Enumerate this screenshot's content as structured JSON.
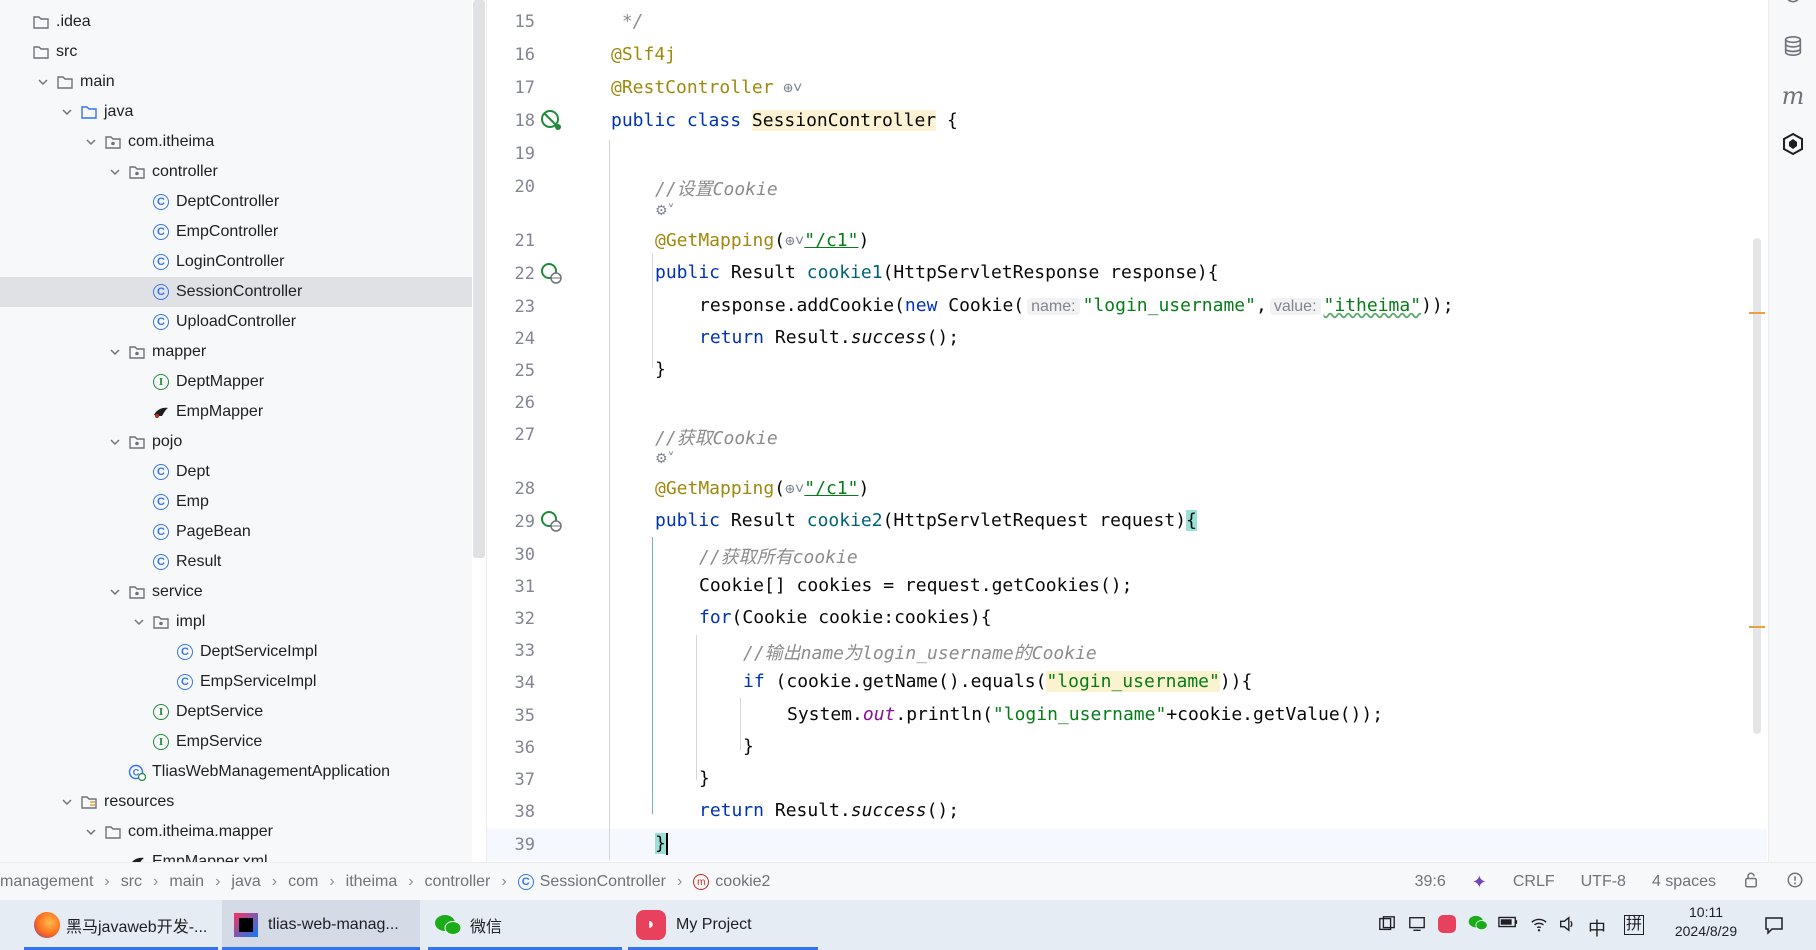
{
  "project_tree": {
    "items": [
      {
        "label": ".idea",
        "type": "folder",
        "expanded": false
      },
      {
        "label": "src",
        "type": "folder",
        "expanded": false
      },
      {
        "label": "main",
        "type": "folder",
        "expanded": true
      },
      {
        "label": "java",
        "type": "source-folder",
        "expanded": true
      },
      {
        "label": "com.itheima",
        "type": "package",
        "expanded": true
      },
      {
        "label": "controller",
        "type": "package",
        "expanded": true
      },
      {
        "label": "DeptController",
        "type": "class"
      },
      {
        "label": "EmpController",
        "type": "class"
      },
      {
        "label": "LoginController",
        "type": "class"
      },
      {
        "label": "SessionController",
        "type": "class",
        "selected": true
      },
      {
        "label": "UploadController",
        "type": "class"
      },
      {
        "label": "mapper",
        "type": "package",
        "expanded": true
      },
      {
        "label": "DeptMapper",
        "type": "interface"
      },
      {
        "label": "EmpMapper",
        "type": "mapper"
      },
      {
        "label": "pojo",
        "type": "package",
        "expanded": true
      },
      {
        "label": "Dept",
        "type": "class"
      },
      {
        "label": "Emp",
        "type": "class"
      },
      {
        "label": "PageBean",
        "type": "class"
      },
      {
        "label": "Result",
        "type": "class"
      },
      {
        "label": "service",
        "type": "package",
        "expanded": true
      },
      {
        "label": "impl",
        "type": "package",
        "expanded": true
      },
      {
        "label": "DeptServiceImpl",
        "type": "class"
      },
      {
        "label": "EmpServiceImpl",
        "type": "class"
      },
      {
        "label": "DeptService",
        "type": "interface"
      },
      {
        "label": "EmpService",
        "type": "interface"
      },
      {
        "label": "TliasWebManagementApplication",
        "type": "app"
      },
      {
        "label": "resources",
        "type": "resource-folder",
        "expanded": true
      },
      {
        "label": "com.itheima.mapper",
        "type": "folder",
        "expanded": true
      },
      {
        "label": "EmpMapper.xml",
        "type": "xml"
      }
    ]
  },
  "editor": {
    "lines": {
      "l15": {
        "no": "15",
        "text": " */"
      },
      "l16": {
        "no": "16",
        "text": "@Slf4j"
      },
      "l17": {
        "no": "17",
        "text": "@RestController"
      },
      "l18": {
        "no": "18",
        "kw1": "public",
        "kw2": "class",
        "cls": "SessionController",
        "rest": " {"
      },
      "l19": {
        "no": "19"
      },
      "l20": {
        "no": "20",
        "text": "//设置Cookie"
      },
      "l21": {
        "no": "21",
        "ann": "@GetMapping",
        "open": "(",
        "str": "\"/c1\"",
        "close": ")"
      },
      "l22": {
        "no": "22",
        "kw": "public",
        "a": " Result ",
        "fn": "cookie1",
        "b": "(HttpServletResponse response){"
      },
      "l23": {
        "no": "23",
        "a": "response.addCookie(",
        "kw": "new",
        "b": " Cookie(",
        "hint1": "name:",
        "s1": "\"login_username\"",
        "c": ",",
        "hint2": "value:",
        "s2": "\"itheima\"",
        "d": "));"
      },
      "l24": {
        "no": "24",
        "kw": "return",
        "a": " Result.",
        "it": "success",
        "b": "();"
      },
      "l25": {
        "no": "25",
        "text": "}"
      },
      "l26": {
        "no": "26"
      },
      "l27": {
        "no": "27",
        "text": "//获取Cookie"
      },
      "l28": {
        "no": "28",
        "ann": "@GetMapping",
        "open": "(",
        "str": "\"/c1\"",
        "close": ")"
      },
      "l29": {
        "no": "29",
        "kw": "public",
        "a": " Result ",
        "fn": "cookie2",
        "b": "(HttpServletRequest request)",
        "brace": "{"
      },
      "l30": {
        "no": "30",
        "text": "//获取所有cookie"
      },
      "l31": {
        "no": "31",
        "text": "Cookie[] cookies = request.getCookies();"
      },
      "l32": {
        "no": "32",
        "kw": "for",
        "a": "(Cookie cookie:cookies){"
      },
      "l33": {
        "no": "33",
        "text": "//输出name为login_username的Cookie"
      },
      "l34": {
        "no": "34",
        "kw": "if",
        "a": " (cookie.getName().equals(",
        "str": "\"login_username\"",
        "b": ")){"
      },
      "l35": {
        "no": "35",
        "a": "System.",
        "st": "out",
        "b": ".println(",
        "str": "\"login_username\"",
        "c": "+cookie.getValue());"
      },
      "l36": {
        "no": "36",
        "text": "}"
      },
      "l37": {
        "no": "37",
        "text": "}"
      },
      "l38": {
        "no": "38",
        "kw": "return",
        "a": " Result.",
        "it": "success",
        "b": "();"
      },
      "l39": {
        "no": "39",
        "text": "}"
      }
    }
  },
  "breadcrumb": [
    "management",
    "src",
    "main",
    "java",
    "com",
    "itheima",
    "controller",
    "SessionController",
    "cookie2"
  ],
  "status": {
    "position": "39:6",
    "line_sep": "CRLF",
    "encoding": "UTF-8",
    "indent": "4 spaces"
  },
  "taskbar": {
    "apps": [
      {
        "label": "黑马javaweb开发-..."
      },
      {
        "label": "tlias-web-manag..."
      },
      {
        "label": "微信"
      },
      {
        "label": "My Project"
      }
    ],
    "ime": "中",
    "ime2": "拼",
    "time": "10:11",
    "date": "2024/8/29"
  },
  "colors": {
    "accent": "#3574f0",
    "keyword": "#0033b3",
    "annotation": "#9e880d",
    "string": "#067d17",
    "comment": "#8c8c8c"
  }
}
